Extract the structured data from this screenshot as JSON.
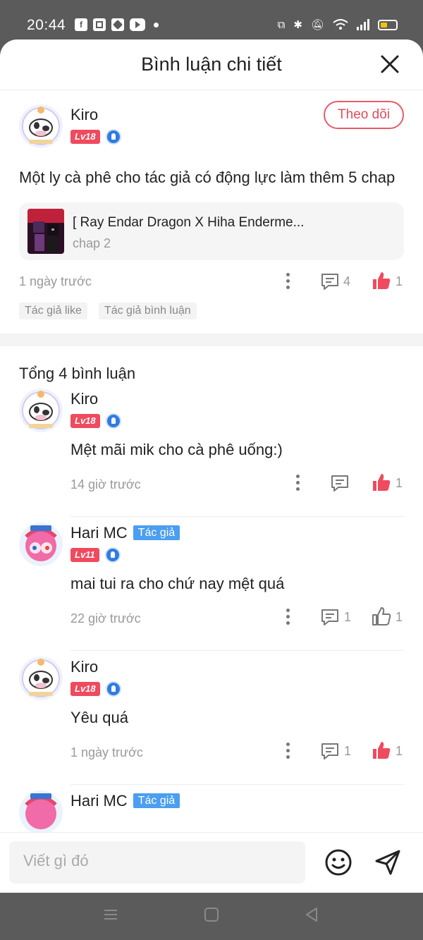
{
  "status_bar": {
    "time": "20:44",
    "apps": [
      "f",
      "⬚",
      "◩",
      "▶"
    ]
  },
  "sheet": {
    "title": "Bình luận chi tiết"
  },
  "main_comment": {
    "username": "Kiro",
    "level": "Lv18",
    "follow_label": "Theo dõi",
    "text": "Một ly cà phê cho tác giả có động lực làm thêm 5 chap",
    "chapter": {
      "title": "[ Ray Endar Dragon X Hiha Enderme...",
      "sub": "chap 2"
    },
    "time": "1 ngày trước",
    "reply_count": "4",
    "like_count": "1",
    "tags": [
      "Tác giả like",
      "Tác giả bình luận"
    ]
  },
  "total_label": "Tổng 4 bình luận",
  "replies": [
    {
      "username": "Kiro",
      "level": "Lv18",
      "text": "Mệt mãi mik cho cà phê uống:)",
      "time": "14 giờ trước",
      "reply_count": "",
      "like_count": "1"
    },
    {
      "username": "Hari MC",
      "author_label": "Tác giả",
      "level": "Lv11",
      "text": "mai tui ra cho chứ nay mệt quá",
      "time": "22 giờ trước",
      "reply_count": "1",
      "like_count": "1"
    },
    {
      "username": "Kiro",
      "level": "Lv18",
      "text": "Yêu quá",
      "time": "1 ngày trước",
      "reply_count": "1",
      "like_count": "1"
    },
    {
      "username": "Hari MC",
      "author_label": "Tác giả"
    }
  ],
  "input": {
    "placeholder": "Viết gì đó"
  },
  "colors": {
    "accent": "#e85a6b",
    "like": "#f04a5e",
    "author_tag": "#4b9ef0"
  }
}
